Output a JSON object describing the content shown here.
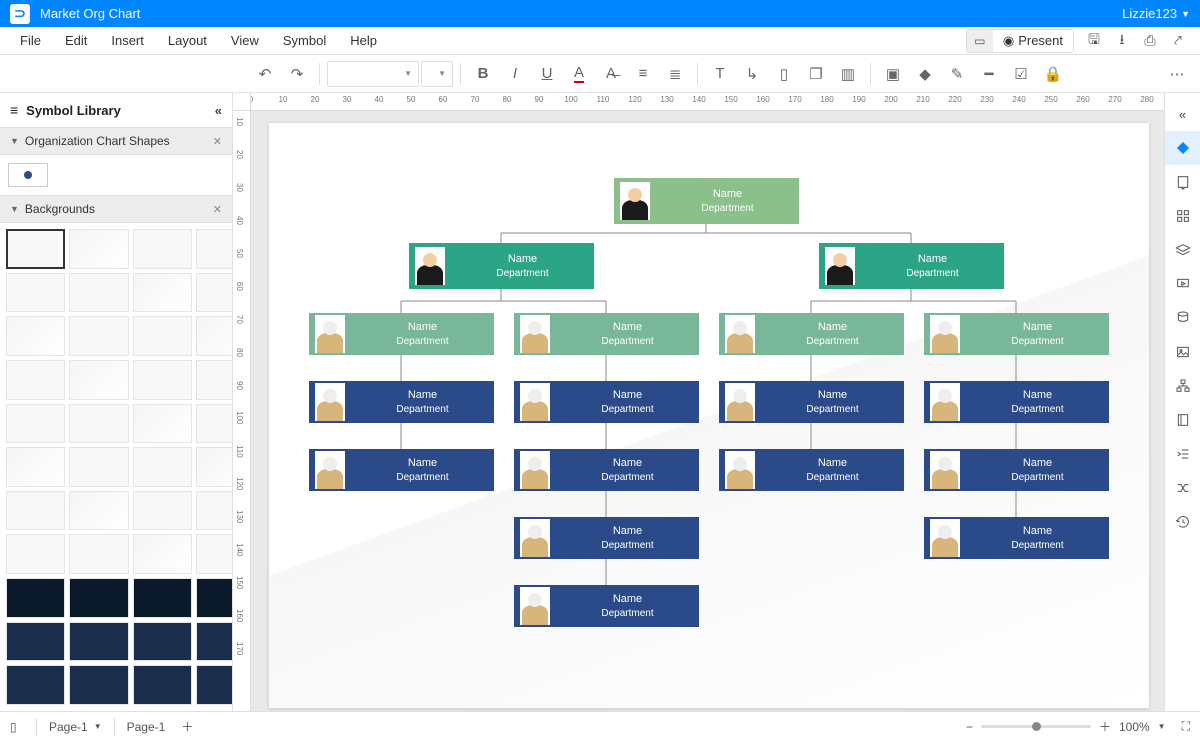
{
  "app": {
    "title": "Market Org Chart",
    "user": "Lizzie123"
  },
  "menu": {
    "file": "File",
    "edit": "Edit",
    "insert": "Insert",
    "layout": "Layout",
    "view": "View",
    "symbol": "Symbol",
    "help": "Help",
    "present": "Present"
  },
  "left": {
    "library": "Symbol Library",
    "section1": "Organization Chart Shapes",
    "section2": "Backgrounds"
  },
  "bottom": {
    "pagedrop": "Page-1",
    "pagetab": "Page-1",
    "zoom": "100%"
  },
  "node_defaults": {
    "name": "Name",
    "dept": "Department"
  },
  "colors": {
    "root": "#8cc08a",
    "lvl2": "#2ca587",
    "lvl3": "#78b79a",
    "lvl4": "#2a4a8a"
  },
  "ruler_h": [
    0,
    10,
    20,
    30,
    40,
    50,
    60,
    70,
    80,
    90,
    100,
    110,
    120,
    130,
    140,
    150,
    160,
    170,
    180,
    190,
    200,
    210,
    220,
    230,
    240,
    250,
    260,
    270,
    280
  ],
  "ruler_v": [
    10,
    20,
    30,
    40,
    50,
    60,
    70,
    80,
    90,
    100,
    110,
    120,
    130,
    140,
    150,
    160,
    170
  ]
}
